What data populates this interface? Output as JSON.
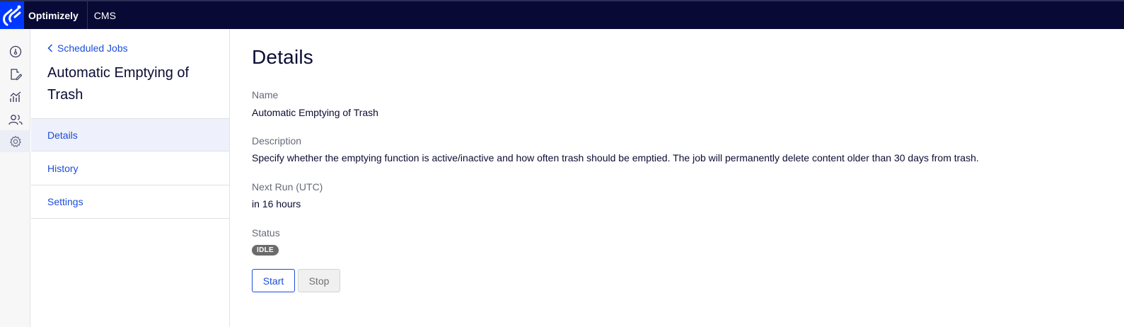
{
  "header": {
    "brand": "Optimizely",
    "product": "CMS",
    "logo_icon": "optimizely-logo-icon",
    "colors": {
      "bar": "#080a35",
      "logo_bg": "#0037ff"
    }
  },
  "rail": {
    "items": [
      {
        "icon": "dashboard-icon"
      },
      {
        "icon": "edit-icon"
      },
      {
        "icon": "reports-icon"
      },
      {
        "icon": "visitor-groups-icon"
      },
      {
        "icon": "settings-icon",
        "active": true
      }
    ]
  },
  "subnav": {
    "back_label": "Scheduled Jobs",
    "title": "Automatic Emptying of Trash",
    "items": [
      {
        "label": "Details",
        "active": true
      },
      {
        "label": "History"
      },
      {
        "label": "Settings"
      }
    ]
  },
  "main": {
    "title": "Details",
    "name_label": "Name",
    "name_value": "Automatic Emptying of Trash",
    "description_label": "Description",
    "description_value": "Specify whether the emptying function is active/inactive and how often trash should be emptied. The job will permanently delete content older than 30 days from trash.",
    "next_run_label": "Next Run (UTC)",
    "next_run_value": "in 16 hours",
    "status_label": "Status",
    "status_badge": "IDLE",
    "start_label": "Start",
    "stop_label": "Stop"
  },
  "colors": {
    "accent": "#1c4dd9",
    "text": "#0b0c33"
  }
}
